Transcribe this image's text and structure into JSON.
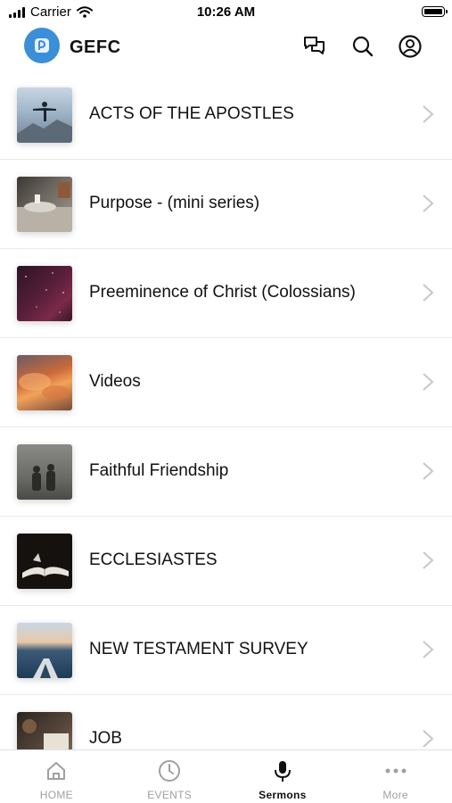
{
  "status_bar": {
    "carrier": "Carrier",
    "time": "10:26 AM"
  },
  "header": {
    "title": "GEFC"
  },
  "sermon_series": [
    {
      "title": "ACTS OF THE APOSTLES",
      "thumb": "man-on-mountain"
    },
    {
      "title": "Purpose - (mini series)",
      "thumb": "coffee-table"
    },
    {
      "title": "Preeminence of Christ (Colossians)",
      "thumb": "night-sky"
    },
    {
      "title": "Videos",
      "thumb": "orange-clouds"
    },
    {
      "title": "Faithful Friendship",
      "thumb": "two-friends"
    },
    {
      "title": "ECCLESIASTES",
      "thumb": "open-book-dark"
    },
    {
      "title": "NEW TESTAMENT SURVEY",
      "thumb": "kayak-water"
    },
    {
      "title": "JOB",
      "thumb": "book-and-cup"
    }
  ],
  "tabs": [
    {
      "label": "HOME",
      "icon": "home-icon",
      "active": false
    },
    {
      "label": "EVENTS",
      "icon": "clock-icon",
      "active": false
    },
    {
      "label": "Sermons",
      "icon": "microphone-icon",
      "active": true
    },
    {
      "label": "More",
      "icon": "more-dots-icon",
      "active": false
    }
  ],
  "colors": {
    "brand": "#3b8ed8",
    "active_tab": "#111111",
    "inactive_tab": "#a0a0a0",
    "divider": "#ebebeb"
  }
}
